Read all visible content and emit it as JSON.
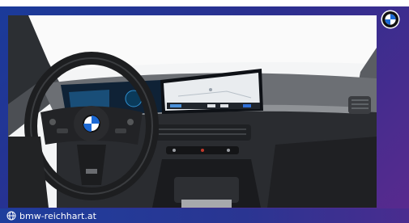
{
  "branding": {
    "website": "bmw-reichhart.at",
    "logo": "bmw-roundel-logo"
  },
  "photo": {
    "subject": "car-interior-photo",
    "icons": [
      "steering-wheel",
      "bmw-roundel",
      "infotainment-screen"
    ]
  },
  "colors": {
    "gradient_start": "#1a3b9a",
    "gradient_end": "#5a2a8e",
    "bmw_blue": "#1c69d4"
  }
}
